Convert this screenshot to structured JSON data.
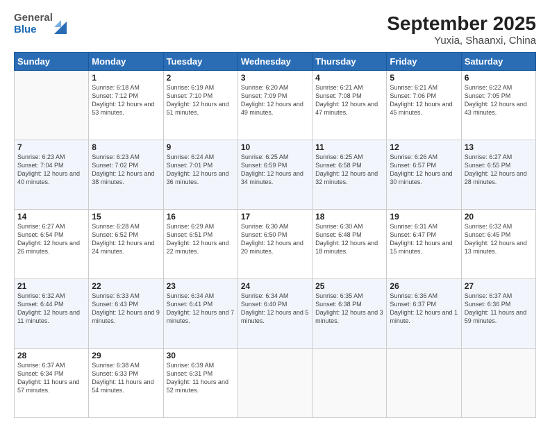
{
  "header": {
    "logo_line1": "General",
    "logo_line2": "Blue",
    "title": "September 2025",
    "subtitle": "Yuxia, Shaanxi, China"
  },
  "weekdays": [
    "Sunday",
    "Monday",
    "Tuesday",
    "Wednesday",
    "Thursday",
    "Friday",
    "Saturday"
  ],
  "weeks": [
    [
      {
        "day": "",
        "sunrise": "",
        "sunset": "",
        "daylight": ""
      },
      {
        "day": "1",
        "sunrise": "Sunrise: 6:18 AM",
        "sunset": "Sunset: 7:12 PM",
        "daylight": "Daylight: 12 hours and 53 minutes."
      },
      {
        "day": "2",
        "sunrise": "Sunrise: 6:19 AM",
        "sunset": "Sunset: 7:10 PM",
        "daylight": "Daylight: 12 hours and 51 minutes."
      },
      {
        "day": "3",
        "sunrise": "Sunrise: 6:20 AM",
        "sunset": "Sunset: 7:09 PM",
        "daylight": "Daylight: 12 hours and 49 minutes."
      },
      {
        "day": "4",
        "sunrise": "Sunrise: 6:21 AM",
        "sunset": "Sunset: 7:08 PM",
        "daylight": "Daylight: 12 hours and 47 minutes."
      },
      {
        "day": "5",
        "sunrise": "Sunrise: 6:21 AM",
        "sunset": "Sunset: 7:06 PM",
        "daylight": "Daylight: 12 hours and 45 minutes."
      },
      {
        "day": "6",
        "sunrise": "Sunrise: 6:22 AM",
        "sunset": "Sunset: 7:05 PM",
        "daylight": "Daylight: 12 hours and 43 minutes."
      }
    ],
    [
      {
        "day": "7",
        "sunrise": "Sunrise: 6:23 AM",
        "sunset": "Sunset: 7:04 PM",
        "daylight": "Daylight: 12 hours and 40 minutes."
      },
      {
        "day": "8",
        "sunrise": "Sunrise: 6:23 AM",
        "sunset": "Sunset: 7:02 PM",
        "daylight": "Daylight: 12 hours and 38 minutes."
      },
      {
        "day": "9",
        "sunrise": "Sunrise: 6:24 AM",
        "sunset": "Sunset: 7:01 PM",
        "daylight": "Daylight: 12 hours and 36 minutes."
      },
      {
        "day": "10",
        "sunrise": "Sunrise: 6:25 AM",
        "sunset": "Sunset: 6:59 PM",
        "daylight": "Daylight: 12 hours and 34 minutes."
      },
      {
        "day": "11",
        "sunrise": "Sunrise: 6:25 AM",
        "sunset": "Sunset: 6:58 PM",
        "daylight": "Daylight: 12 hours and 32 minutes."
      },
      {
        "day": "12",
        "sunrise": "Sunrise: 6:26 AM",
        "sunset": "Sunset: 6:57 PM",
        "daylight": "Daylight: 12 hours and 30 minutes."
      },
      {
        "day": "13",
        "sunrise": "Sunrise: 6:27 AM",
        "sunset": "Sunset: 6:55 PM",
        "daylight": "Daylight: 12 hours and 28 minutes."
      }
    ],
    [
      {
        "day": "14",
        "sunrise": "Sunrise: 6:27 AM",
        "sunset": "Sunset: 6:54 PM",
        "daylight": "Daylight: 12 hours and 26 minutes."
      },
      {
        "day": "15",
        "sunrise": "Sunrise: 6:28 AM",
        "sunset": "Sunset: 6:52 PM",
        "daylight": "Daylight: 12 hours and 24 minutes."
      },
      {
        "day": "16",
        "sunrise": "Sunrise: 6:29 AM",
        "sunset": "Sunset: 6:51 PM",
        "daylight": "Daylight: 12 hours and 22 minutes."
      },
      {
        "day": "17",
        "sunrise": "Sunrise: 6:30 AM",
        "sunset": "Sunset: 6:50 PM",
        "daylight": "Daylight: 12 hours and 20 minutes."
      },
      {
        "day": "18",
        "sunrise": "Sunrise: 6:30 AM",
        "sunset": "Sunset: 6:48 PM",
        "daylight": "Daylight: 12 hours and 18 minutes."
      },
      {
        "day": "19",
        "sunrise": "Sunrise: 6:31 AM",
        "sunset": "Sunset: 6:47 PM",
        "daylight": "Daylight: 12 hours and 15 minutes."
      },
      {
        "day": "20",
        "sunrise": "Sunrise: 6:32 AM",
        "sunset": "Sunset: 6:45 PM",
        "daylight": "Daylight: 12 hours and 13 minutes."
      }
    ],
    [
      {
        "day": "21",
        "sunrise": "Sunrise: 6:32 AM",
        "sunset": "Sunset: 6:44 PM",
        "daylight": "Daylight: 12 hours and 11 minutes."
      },
      {
        "day": "22",
        "sunrise": "Sunrise: 6:33 AM",
        "sunset": "Sunset: 6:43 PM",
        "daylight": "Daylight: 12 hours and 9 minutes."
      },
      {
        "day": "23",
        "sunrise": "Sunrise: 6:34 AM",
        "sunset": "Sunset: 6:41 PM",
        "daylight": "Daylight: 12 hours and 7 minutes."
      },
      {
        "day": "24",
        "sunrise": "Sunrise: 6:34 AM",
        "sunset": "Sunset: 6:40 PM",
        "daylight": "Daylight: 12 hours and 5 minutes."
      },
      {
        "day": "25",
        "sunrise": "Sunrise: 6:35 AM",
        "sunset": "Sunset: 6:38 PM",
        "daylight": "Daylight: 12 hours and 3 minutes."
      },
      {
        "day": "26",
        "sunrise": "Sunrise: 6:36 AM",
        "sunset": "Sunset: 6:37 PM",
        "daylight": "Daylight: 12 hours and 1 minute."
      },
      {
        "day": "27",
        "sunrise": "Sunrise: 6:37 AM",
        "sunset": "Sunset: 6:36 PM",
        "daylight": "Daylight: 11 hours and 59 minutes."
      }
    ],
    [
      {
        "day": "28",
        "sunrise": "Sunrise: 6:37 AM",
        "sunset": "Sunset: 6:34 PM",
        "daylight": "Daylight: 11 hours and 57 minutes."
      },
      {
        "day": "29",
        "sunrise": "Sunrise: 6:38 AM",
        "sunset": "Sunset: 6:33 PM",
        "daylight": "Daylight: 11 hours and 54 minutes."
      },
      {
        "day": "30",
        "sunrise": "Sunrise: 6:39 AM",
        "sunset": "Sunset: 6:31 PM",
        "daylight": "Daylight: 11 hours and 52 minutes."
      },
      {
        "day": "",
        "sunrise": "",
        "sunset": "",
        "daylight": ""
      },
      {
        "day": "",
        "sunrise": "",
        "sunset": "",
        "daylight": ""
      },
      {
        "day": "",
        "sunrise": "",
        "sunset": "",
        "daylight": ""
      },
      {
        "day": "",
        "sunrise": "",
        "sunset": "",
        "daylight": ""
      }
    ]
  ]
}
